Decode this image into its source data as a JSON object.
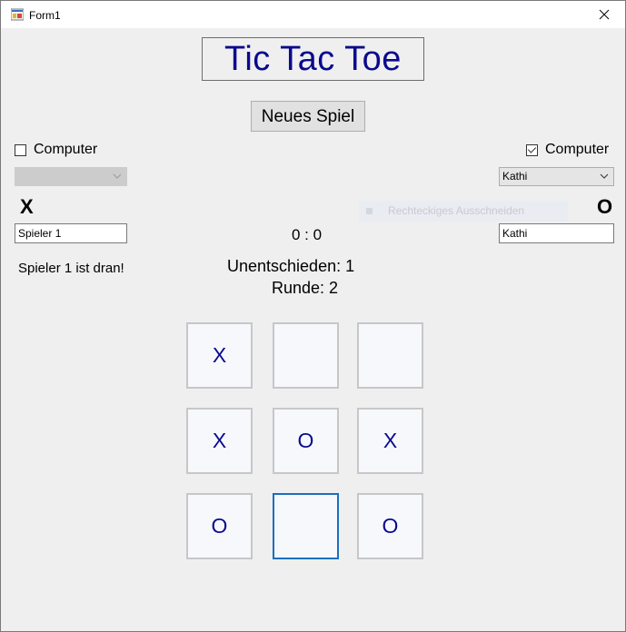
{
  "window": {
    "title": "Form1"
  },
  "game": {
    "title": "Tic Tac Toe",
    "new_game_label": "Neues Spiel"
  },
  "player_left": {
    "computer_label": "Computer",
    "computer_checked": false,
    "combo_value": "",
    "combo_enabled": false,
    "symbol": "X",
    "name": "Spieler 1"
  },
  "player_right": {
    "computer_label": "Computer",
    "computer_checked": true,
    "combo_value": "Kathi",
    "combo_enabled": true,
    "symbol": "O",
    "name": "Kathi"
  },
  "score": "0 : 0",
  "status": {
    "turn": "Spieler 1 ist dran!",
    "draws": "Unentschieden: 1",
    "round": "Runde: 2"
  },
  "overlay": {
    "ghost_tooltip": "Rechteckiges Ausschneiden"
  },
  "board": [
    [
      "X",
      "",
      ""
    ],
    [
      "X",
      "O",
      "X"
    ],
    [
      "O",
      "",
      "O"
    ]
  ],
  "colors": {
    "title_blue": "#0a0a8e",
    "cell_focus": "#1a6fbf",
    "form_bg": "#efefef"
  }
}
